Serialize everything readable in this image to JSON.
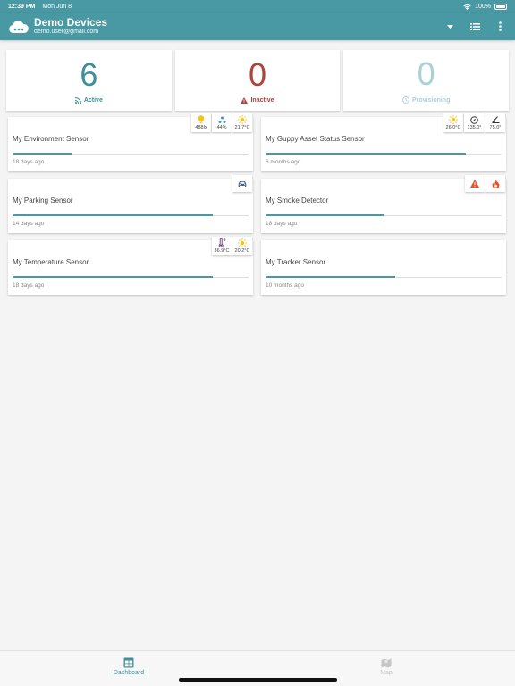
{
  "status_bar": {
    "time": "12:39 PM",
    "date": "Mon Jun 8",
    "battery": "100%"
  },
  "header": {
    "title": "Demo Devices",
    "subtitle": "demo.user@gmail.com",
    "accent": "#4899a3"
  },
  "stats": [
    {
      "value": "6",
      "label": "Active",
      "icon": "rss-icon",
      "color": "#3d8f9a"
    },
    {
      "value": "0",
      "label": "Inactive",
      "icon": "warning-icon",
      "color": "#b0423a"
    },
    {
      "value": "0",
      "label": "Provisioning",
      "icon": "clock-icon",
      "color": "#a8d2d8"
    }
  ],
  "devices": [
    {
      "name": "My Environment Sensor",
      "ago": "18 days ago",
      "progress": 0.25,
      "readings": [
        {
          "icon": "lightbulb-icon",
          "value": "488lx"
        },
        {
          "icon": "humidity-icon",
          "value": "44%"
        },
        {
          "icon": "sun-icon",
          "value": "21.7°C"
        }
      ]
    },
    {
      "name": "My Guppy Asset Status Sensor",
      "ago": "6 months ago",
      "progress": 0.85,
      "readings": [
        {
          "icon": "sun-icon",
          "value": "26.0°C"
        },
        {
          "icon": "compass-icon",
          "value": "135.0°"
        },
        {
          "icon": "angle-icon",
          "value": "75.0°"
        }
      ]
    },
    {
      "name": "My Parking Sensor",
      "ago": "14 days ago",
      "progress": 0.85,
      "readings": [
        {
          "icon": "car-icon",
          "value": ""
        }
      ]
    },
    {
      "name": "My Smoke Detector",
      "ago": "18 days ago",
      "progress": 0.5,
      "readings": [
        {
          "icon": "warning-icon",
          "value": ""
        },
        {
          "icon": "fire-icon",
          "value": ""
        }
      ]
    },
    {
      "name": "My Temperature Sensor",
      "ago": "18 days ago",
      "progress": 0.85,
      "readings": [
        {
          "icon": "thermometer-icon",
          "value": "36.9°C"
        },
        {
          "icon": "sun-icon",
          "value": "20.2°C"
        }
      ]
    },
    {
      "name": "My Tracker Sensor",
      "ago": "10 months ago",
      "progress": 0.55,
      "readings": []
    }
  ],
  "tabs": [
    {
      "label": "Dashboard",
      "icon": "dashboard-icon",
      "selected": true
    },
    {
      "label": "Map",
      "icon": "map-icon",
      "selected": false
    }
  ]
}
